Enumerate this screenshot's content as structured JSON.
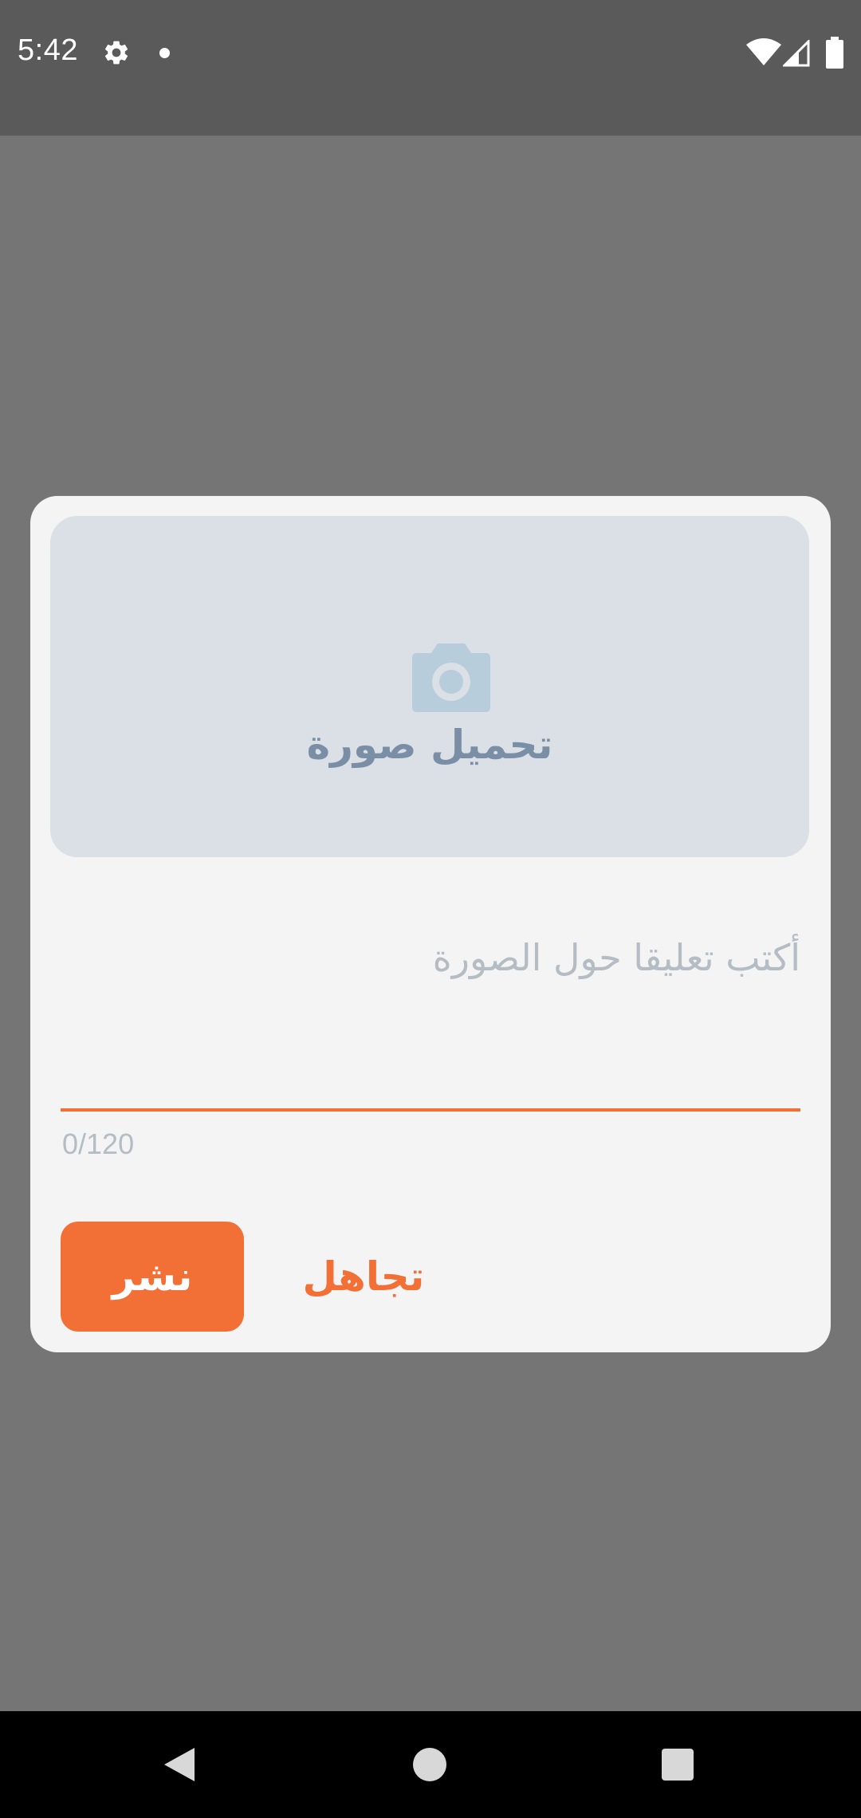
{
  "status_bar": {
    "time": "5:42",
    "icons": [
      "gear-icon",
      "notification-dot",
      "wifi-icon",
      "signal-icon",
      "battery-icon"
    ]
  },
  "dialog": {
    "upload_label": "تحميل صورة",
    "upload_icon": "camera-icon",
    "caption_placeholder": "أكتب تعليقا حول الصورة",
    "caption_value": "",
    "char_counter": "0/120",
    "publish_label": "نشر",
    "ignore_label": "تجاهل"
  },
  "nav_bar": {
    "icons": [
      "back-icon",
      "home-icon",
      "recents-icon"
    ]
  },
  "colors": {
    "accent": "#f26f36",
    "upload_bg": "#dae0e5",
    "upload_text": "#7a8fa6",
    "camera_icon": "#b7cddb",
    "placeholder_text": "#b4bcc4",
    "scrim": "#757575",
    "dialog_bg": "#f4f4f4"
  }
}
